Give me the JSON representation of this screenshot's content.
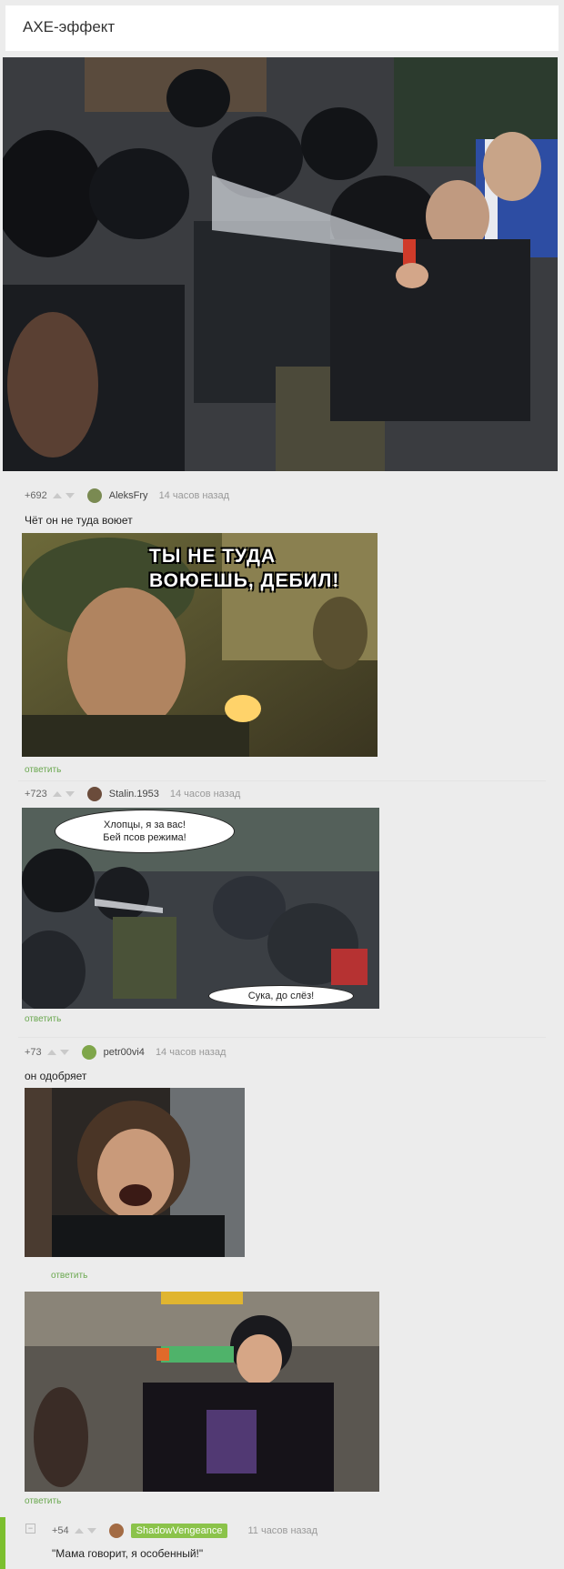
{
  "post": {
    "title": "АХЕ-эффект"
  },
  "comments": [
    {
      "rating": "+692",
      "user": "AleksFry",
      "time": "14 часов назад",
      "text": "Чёт он не туда воюет",
      "image_caption": "ТЫ НЕ ТУДА\nВОЮЕШЬ, ДЕБИЛ!",
      "reply_label": "ответить"
    },
    {
      "rating": "+723",
      "user": "Stalin.1953",
      "time": "14 часов назад",
      "bubble_top": "Хлопцы, я за вас!\nБей псов режима!",
      "bubble_bottom": "Сука, до слёз!",
      "reply_label": "ответить"
    },
    {
      "rating": "+73",
      "user": "petr00vi4",
      "time": "14 часов назад",
      "text": "он одобряет",
      "reply_label": "ответить"
    },
    {
      "reply_label": "ответить"
    },
    {
      "rating": "+54",
      "user": "ShadowVengeance",
      "time": "11 часов назад",
      "text": "\"Мама говорит, я особенный!\"",
      "collapse": "−"
    }
  ],
  "colors": {
    "accent": "#6aa84f",
    "badge": "#8bc34a"
  }
}
